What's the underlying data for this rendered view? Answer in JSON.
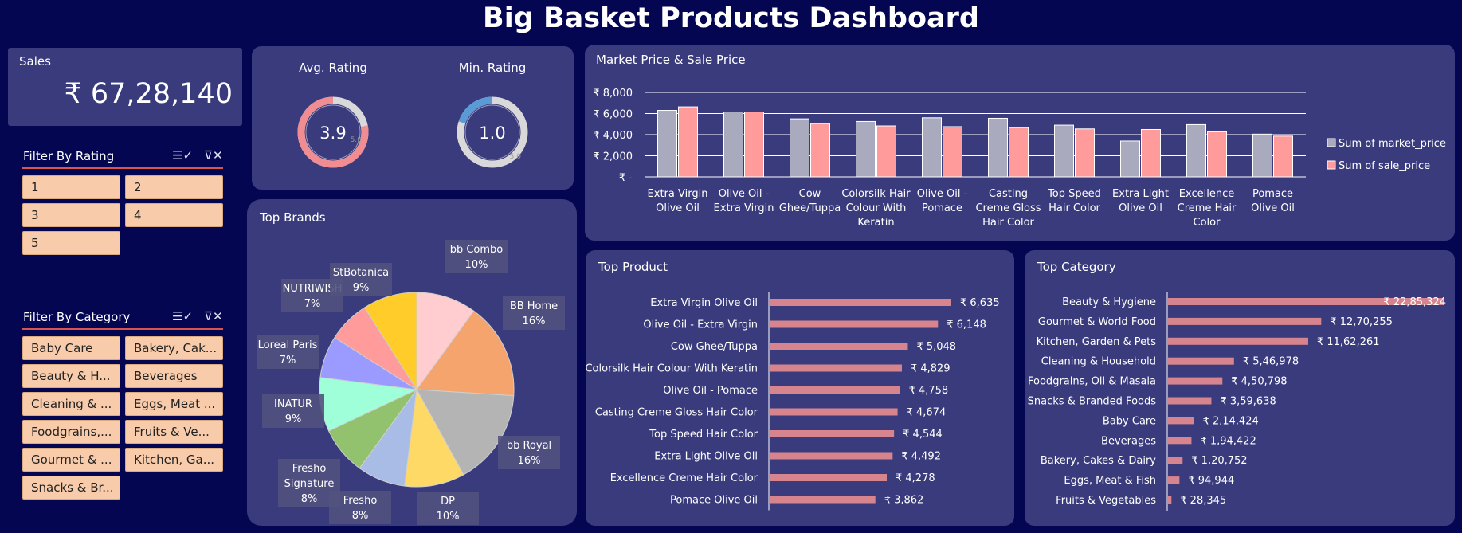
{
  "header": {
    "title": "Big Basket Products Dashboard"
  },
  "sales": {
    "label": "Sales",
    "value": "₹ 67,28,140"
  },
  "filter_rating": {
    "title": "Filter By Rating",
    "items": [
      "1",
      "2",
      "3",
      "4",
      "5"
    ],
    "icons": [
      "multi-select-icon",
      "clear-filter-icon"
    ]
  },
  "filter_category": {
    "title": "Filter By Category",
    "items": [
      "Baby Care",
      "Bakery, Cak...",
      "Beauty & H...",
      "Beverages",
      "Cleaning & ...",
      "Eggs, Meat ...",
      "Foodgrains,...",
      "Fruits & Ve...",
      "Gourmet & ...",
      "Kitchen, Ga...",
      "Snacks & Br..."
    ],
    "icons": [
      "multi-select-icon",
      "clear-filter-icon"
    ]
  },
  "colors": {
    "background": "#040652",
    "panel": "#3a3b7c",
    "chip": "#f8ccab",
    "market_price": "#aaaabf",
    "sale_price": "#ff9b9b",
    "hbar": "#d6848d",
    "gauge_avg": "#f08d93",
    "gauge_min": "#5b9bd5",
    "gauge_track": "#d9d9d9"
  },
  "chart_data": [
    {
      "type": "gauge",
      "title": "Avg. Rating",
      "value": 3.9,
      "value_label": "3.9",
      "max": 5,
      "max_label": "5.0"
    },
    {
      "type": "gauge",
      "title": "Min. Rating",
      "value": 1.0,
      "value_label": "1.0",
      "max": 5,
      "max_label": "5.0"
    },
    {
      "type": "bar",
      "title": "Market Price & Sale Price",
      "categories": [
        "Extra Virgin Olive Oil",
        "Olive Oil - Extra Virgin",
        "Cow Ghee/Tuppa",
        "Colorsilk Hair Colour With Keratin",
        "Olive Oil - Pomace",
        "Casting Creme Gloss Hair Color",
        "Top Speed Hair Color",
        "Extra Light Olive Oil",
        "Excellence Creme Hair Color",
        "Pomace Olive Oil"
      ],
      "category_lines": [
        [
          "Extra Virgin",
          "Olive Oil"
        ],
        [
          "Olive Oil -",
          "Extra Virgin"
        ],
        [
          "Cow",
          "Ghee/Tuppa"
        ],
        [
          "Colorsilk Hair",
          "Colour With",
          "Keratin"
        ],
        [
          "Olive Oil -",
          "Pomace"
        ],
        [
          "Casting",
          "Creme Gloss",
          "Hair Color"
        ],
        [
          "Top Speed",
          "Hair Color"
        ],
        [
          "Extra Light",
          "Olive Oil"
        ],
        [
          "Excellence",
          "Creme Hair",
          "Color"
        ],
        [
          "Pomace",
          "Olive Oil"
        ]
      ],
      "series": [
        {
          "name": "Sum of market_price",
          "values": [
            6300,
            6150,
            5500,
            5250,
            5600,
            5550,
            4900,
            3400,
            4950,
            4050
          ]
        },
        {
          "name": "Sum of sale_price",
          "values": [
            6635,
            6148,
            5048,
            4829,
            4758,
            4674,
            4544,
            4492,
            4278,
            3862
          ]
        }
      ],
      "ylim": [
        0,
        8000
      ],
      "y_ticks": [
        0,
        2000,
        4000,
        6000,
        8000
      ],
      "y_tick_labels": [
        "₹ -",
        "₹ 2,000",
        "₹ 4,000",
        "₹ 6,000",
        "₹ 8,000"
      ],
      "grid": true,
      "legend": "right"
    },
    {
      "type": "pie",
      "title": "Top Brands",
      "labels": [
        "bb Combo",
        "BB Home",
        "bb Royal",
        "DP",
        "Fresho",
        "Fresho Signature",
        "INATUR",
        "Loreal Paris",
        "NUTRIWISH",
        "StBotanica"
      ],
      "values": [
        10,
        16,
        16,
        10,
        8,
        8,
        9,
        7,
        7,
        9
      ],
      "value_labels": [
        "10%",
        "16%",
        "16%",
        "10%",
        "8%",
        "8%",
        "9%",
        "7%",
        "7%",
        "9%"
      ],
      "colors": [
        "#ffccd0",
        "#f4a46c",
        "#b4b4b4",
        "#ffd966",
        "#a9bce6",
        "#92c26d",
        "#9fffd8",
        "#9b9bff",
        "#ff9b9b",
        "#ffcc29"
      ]
    },
    {
      "type": "bar",
      "orientation": "horizontal",
      "title": "Top Product",
      "categories": [
        "Extra Virgin Olive Oil",
        "Olive Oil - Extra Virgin",
        "Cow Ghee/Tuppa",
        "Colorsilk Hair Colour With Keratin",
        "Olive Oil - Pomace",
        "Casting Creme Gloss Hair Color",
        "Top Speed Hair Color",
        "Extra Light Olive Oil",
        "Excellence Creme Hair Color",
        "Pomace Olive Oil"
      ],
      "values": [
        6635,
        6148,
        5048,
        4829,
        4758,
        4674,
        4544,
        4492,
        4278,
        3862
      ],
      "value_labels": [
        "₹ 6,635",
        "₹ 6,148",
        "₹ 5,048",
        "₹ 4,829",
        "₹ 4,758",
        "₹ 4,674",
        "₹ 4,544",
        "₹ 4,492",
        "₹ 4,278",
        "₹ 3,862"
      ]
    },
    {
      "type": "bar",
      "orientation": "horizontal",
      "title": "Top Category",
      "categories": [
        "Beauty & Hygiene",
        "Gourmet & World Food",
        "Kitchen, Garden & Pets",
        "Cleaning & Household",
        "Foodgrains, Oil & Masala",
        "Snacks & Branded Foods",
        "Baby Care",
        "Beverages",
        "Bakery, Cakes & Dairy",
        "Eggs, Meat & Fish",
        "Fruits & Vegetables"
      ],
      "values": [
        2285324,
        1270255,
        1162261,
        546978,
        450798,
        359638,
        214424,
        194422,
        120752,
        94944,
        28345
      ],
      "value_labels": [
        "₹ 22,85,324",
        "₹ 12,70,255",
        "₹ 11,62,261",
        "₹ 5,46,978",
        "₹ 4,50,798",
        "₹ 3,59,638",
        "₹ 2,14,424",
        "₹ 1,94,422",
        "₹ 1,20,752",
        "₹ 94,944",
        "₹ 28,345"
      ]
    }
  ]
}
